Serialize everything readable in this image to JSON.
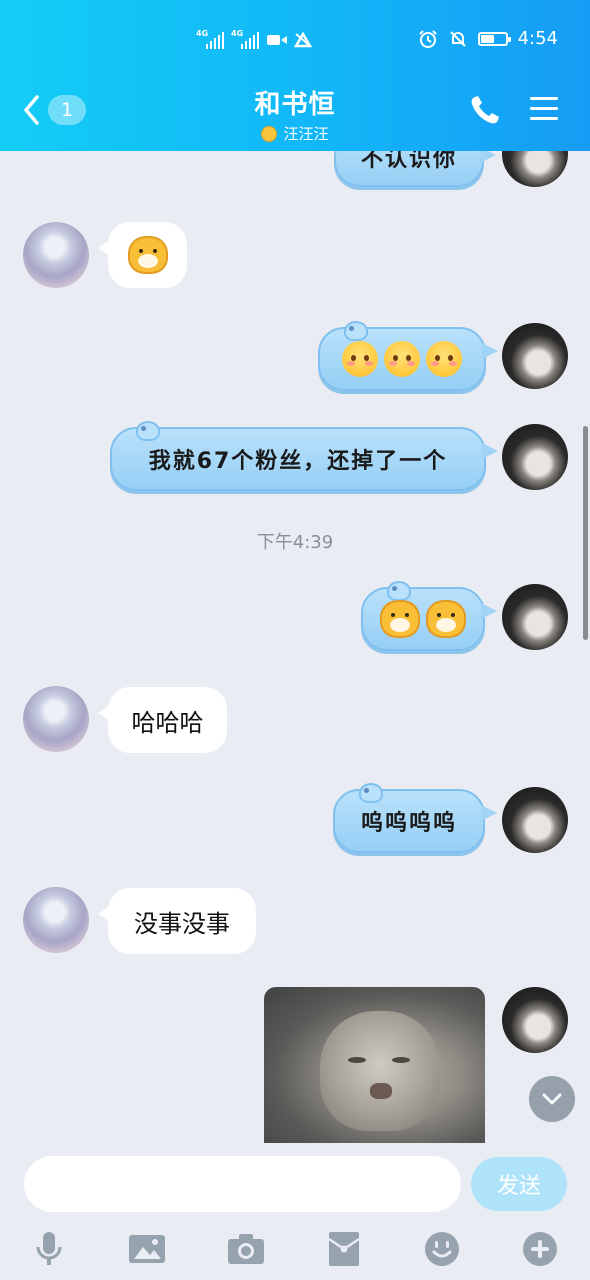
{
  "status_bar": {
    "time": "4:54",
    "signal_label": "4G",
    "battery_level_pct": 60
  },
  "header": {
    "back_badge": "1",
    "title": "和书恒",
    "subtitle": "汪汪汪"
  },
  "messages": [
    {
      "side": "me",
      "type": "text",
      "text": "不认识你"
    },
    {
      "side": "peer",
      "type": "emoji",
      "emoji": "dog"
    },
    {
      "side": "me",
      "type": "emoji",
      "emoji": "blush-face",
      "count": 3
    },
    {
      "side": "me",
      "type": "text",
      "text": "我就67个粉丝，还掉了一个"
    },
    {
      "side": "system",
      "type": "timestamp",
      "text": "下午4:39"
    },
    {
      "side": "me",
      "type": "emoji",
      "emoji": "dog",
      "count": 2
    },
    {
      "side": "peer",
      "type": "text",
      "text": "哈哈哈"
    },
    {
      "side": "me",
      "type": "text",
      "text": "呜呜呜呜"
    },
    {
      "side": "peer",
      "type": "text",
      "text": "没事没事"
    },
    {
      "side": "me",
      "type": "image",
      "image": "pallas-cat-photo"
    }
  ],
  "input": {
    "value": "",
    "send_label": "发送"
  },
  "toolbar": [
    "mic-icon",
    "image-icon",
    "camera-icon",
    "red-packet-icon",
    "emoji-icon",
    "plus-icon"
  ],
  "colors": {
    "header_start": "#13cdf6",
    "header_end": "#169cf5",
    "my_bubble": "#96cff5",
    "background": "#e9ecf2",
    "send_button": "#aee3fa"
  }
}
